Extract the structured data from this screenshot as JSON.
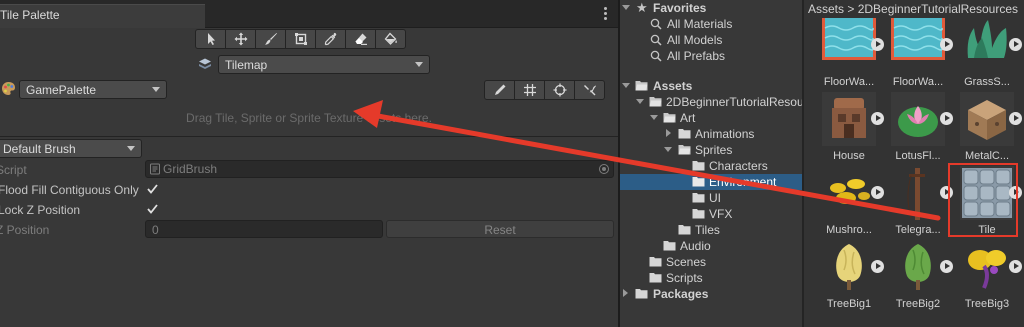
{
  "tile_palette": {
    "tab_title": "Tile Palette",
    "toolbar_tools": [
      "select-tool",
      "move-tool",
      "paint-tool",
      "box-fill-tool",
      "picker-tool",
      "eraser-tool",
      "fill-tool"
    ],
    "active_tilemap": "Tilemap",
    "active_palette": "GamePalette",
    "edit_tools": [
      "edit-tool",
      "grid-tool",
      "gizmo-tool",
      "settings-tool"
    ],
    "drop_hint": "Drag Tile, Sprite or Sprite Texture assets here.",
    "brush": "Default Brush",
    "properties": {
      "script_label": "Script",
      "script_value": "GridBrush",
      "flood_fill_label": "Flood Fill Contiguous Only",
      "flood_fill_checked": true,
      "lock_z_label": "Lock Z Position",
      "lock_z_checked": true,
      "z_position_label": "Z Position",
      "z_position_value": "0",
      "reset_label": "Reset"
    }
  },
  "project": {
    "favorites_label": "Favorites",
    "favorites": [
      "All Materials",
      "All Models",
      "All Prefabs"
    ],
    "assets_label": "Assets",
    "tree": {
      "tutorial": "2DBeginnerTutorialResources",
      "art": "Art",
      "animations": "Animations",
      "sprites": "Sprites",
      "characters": "Characters",
      "environment": "Environment",
      "ui": "UI",
      "vfx": "VFX",
      "tiles": "Tiles",
      "audio": "Audio",
      "scenes": "Scenes",
      "scripts": "Scripts"
    },
    "packages_label": "Packages",
    "breadcrumb": "Assets > 2DBeginnerTutorialResources",
    "assets": [
      {
        "name": "FloorWa...",
        "icon": "floor-water-sprite"
      },
      {
        "name": "FloorWa...",
        "icon": "floor-water-sprite"
      },
      {
        "name": "GrassS...",
        "icon": "grass-sprite"
      },
      {
        "name": "House",
        "icon": "house-sprite"
      },
      {
        "name": "LotusFl...",
        "icon": "lotus-flower-sprite"
      },
      {
        "name": "MetalC...",
        "icon": "metal-cube-sprite"
      },
      {
        "name": "Mushro...",
        "icon": "mushroom-sprite"
      },
      {
        "name": "Telegra...",
        "icon": "telegraph-pole-sprite"
      },
      {
        "name": "Tile",
        "icon": "tile-asset"
      },
      {
        "name": "TreeBig1",
        "icon": "tree-sprite"
      },
      {
        "name": "TreeBig2",
        "icon": "tree-sprite"
      },
      {
        "name": "TreeBig3",
        "icon": "tree-sprite"
      }
    ]
  },
  "colors": {
    "selection": "#2c5d87",
    "annotation": "#e53a2a"
  }
}
